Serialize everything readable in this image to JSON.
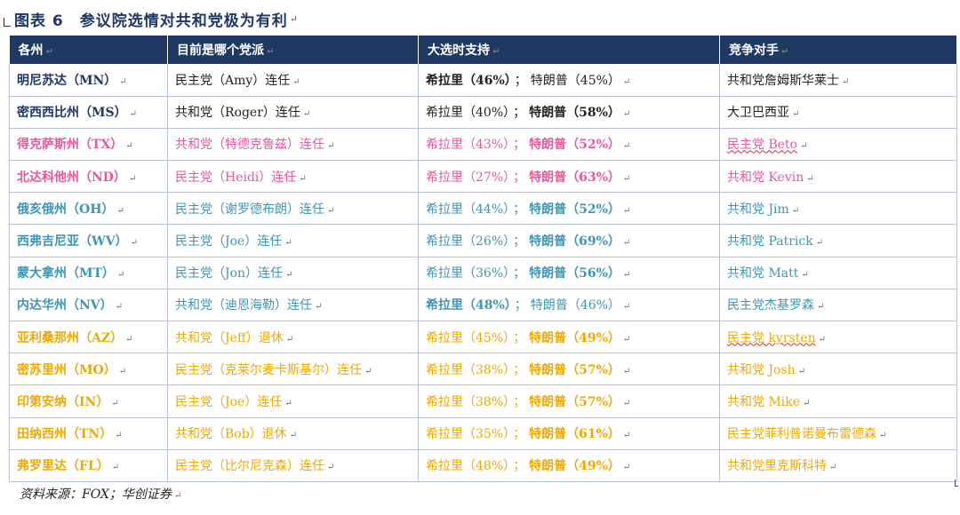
{
  "title": "图表 6　参议院选情对共和党极为有利",
  "paragraph_mark": "↵",
  "colors": {
    "header_bg": "#1f3864",
    "navy": "#1f3864",
    "pink": "#e8589b",
    "teal": "#3f95b4",
    "gold": "#f1a800",
    "black": "#222222"
  },
  "headers": [
    "各州",
    "目前是哪个党派",
    "大选时支持",
    "竞争对手"
  ],
  "rows": [
    {
      "color": "black",
      "state": "明尼苏达（MN）",
      "party": "民主党（Amy）连任",
      "clinton": "希拉里（46%）",
      "clinton_bold": true,
      "semi": "；",
      "trump": "特朗普（45%）",
      "trump_bold": false,
      "rival": "共和党詹姆斯华莱士",
      "rival_squiggle": false,
      "state_color": "navy"
    },
    {
      "color": "black",
      "state": "密西西比州（MS）",
      "party": "共和党（Roger）连任",
      "clinton": "希拉里（40%）",
      "clinton_bold": false,
      "semi": "；",
      "trump": "特朗普（58%）",
      "trump_bold": true,
      "rival": "大卫巴西亚",
      "rival_squiggle": false,
      "state_color": "navy"
    },
    {
      "color": "pink",
      "state": "得克萨斯州（TX）",
      "party": "共和党（特德克鲁兹）连任",
      "clinton": "希拉里（43%）",
      "clinton_bold": false,
      "semi": "；",
      "trump": "特朗普（52%）",
      "trump_bold": true,
      "rival": "民主党 Beto",
      "rival_squiggle": true,
      "state_color": "pink"
    },
    {
      "color": "pink",
      "state": "北达科他州（ND）",
      "party": "民主党（Heidi）连任",
      "clinton": "希拉里（27%）",
      "clinton_bold": false,
      "semi": "；",
      "trump": "特朗普（63%）",
      "trump_bold": true,
      "rival": "共和党 Kevin",
      "rival_squiggle": false,
      "state_color": "pink"
    },
    {
      "color": "teal",
      "state": "俄亥俄州（OH）",
      "party": "民主党（谢罗德布朗）连任",
      "clinton": "希拉里（44%）",
      "clinton_bold": false,
      "semi": "；",
      "trump": "特朗普（52%）",
      "trump_bold": true,
      "rival": "共和党 Jim",
      "rival_squiggle": false,
      "state_color": "teal"
    },
    {
      "color": "teal",
      "state": "西弗吉尼亚（WV）",
      "party": "民主党（Joe）连任",
      "clinton": "希拉里（26%）",
      "clinton_bold": false,
      "semi": "；",
      "trump": "特朗普（69%）",
      "trump_bold": true,
      "rival": "共和党 Patrick",
      "rival_squiggle": false,
      "state_color": "teal"
    },
    {
      "color": "teal",
      "state": "蒙大拿州（MT）",
      "party": "民主党（Jon）连任",
      "clinton": "希拉里（36%）",
      "clinton_bold": false,
      "semi": "；",
      "trump": "特朗普（56%）",
      "trump_bold": true,
      "rival": "共和党 Matt",
      "rival_squiggle": false,
      "state_color": "teal"
    },
    {
      "color": "teal",
      "state": "内达华州（NV）",
      "party": "共和党（迪恩海勒）连任",
      "clinton": "希拉里（48%）",
      "clinton_bold": true,
      "semi": "；",
      "trump": "特朗普（46%）",
      "trump_bold": false,
      "rival": "民主党杰基罗森",
      "rival_squiggle": false,
      "state_color": "teal"
    },
    {
      "color": "gold",
      "state": "亚利桑那州（AZ）",
      "party": "共和党（Jeff）退休",
      "clinton": "希拉里（45%）",
      "clinton_bold": false,
      "semi": "；",
      "trump": "特朗普（49%）",
      "trump_bold": true,
      "rival": "民主党 kyrsten",
      "rival_squiggle": true,
      "state_color": "gold"
    },
    {
      "color": "gold",
      "state": "密苏里州（MO）",
      "party": "民主党（克莱尔麦卡斯基尔）连任",
      "clinton": "希拉里（38%）",
      "clinton_bold": false,
      "semi": "；",
      "trump": "特朗普（57%）",
      "trump_bold": true,
      "rival": "共和党 Josh",
      "rival_squiggle": false,
      "state_color": "gold"
    },
    {
      "color": "gold",
      "state": "印第安纳（IN）",
      "party": "民主党（Joe）连任",
      "clinton": "希拉里（38%）",
      "clinton_bold": false,
      "semi": "；",
      "trump": "特朗普（57%）",
      "trump_bold": true,
      "rival": "共和党 Mike",
      "rival_squiggle": false,
      "state_color": "gold"
    },
    {
      "color": "gold",
      "state": "田纳西州（TN）",
      "party": "共和党（Bob）退休",
      "clinton": "希拉里（35%）",
      "clinton_bold": false,
      "semi": "；",
      "trump": "特朗普（61%）",
      "trump_bold": true,
      "rival": "民主党菲利普诺曼布雷德森",
      "rival_squiggle": false,
      "state_color": "gold"
    },
    {
      "color": "gold",
      "state": "弗罗里达（FL）",
      "party": "民主党（比尔尼克森）连任",
      "clinton": "希拉里（48%）",
      "clinton_bold": false,
      "semi": "；",
      "trump": "特朗普（49%）",
      "trump_bold": true,
      "rival": "共和党里克斯科特",
      "rival_squiggle": false,
      "state_color": "gold"
    }
  ],
  "source": "资料来源：FOX；华创证券"
}
